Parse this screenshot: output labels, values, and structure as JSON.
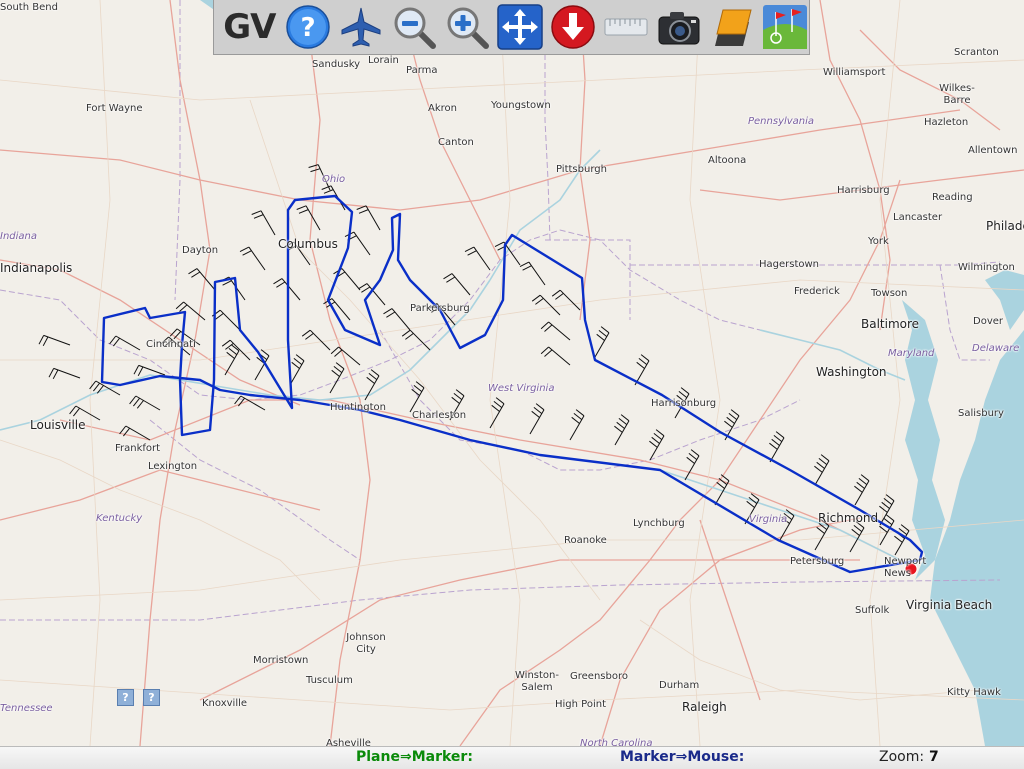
{
  "toolbar": {
    "title": "GV",
    "buttons": [
      {
        "name": "help",
        "icon": "help-icon"
      },
      {
        "name": "plane",
        "icon": "plane-icon"
      },
      {
        "name": "zoom-out",
        "icon": "zoom-out-icon"
      },
      {
        "name": "zoom-in",
        "icon": "zoom-in-icon"
      },
      {
        "name": "pan",
        "icon": "move-arrows-icon"
      },
      {
        "name": "download",
        "icon": "download-arrow-icon"
      },
      {
        "name": "ruler",
        "icon": "ruler-icon"
      },
      {
        "name": "camera",
        "icon": "camera-icon"
      },
      {
        "name": "layers",
        "icon": "layers-icon"
      },
      {
        "name": "google-earth",
        "icon": "google-earth-icon"
      }
    ]
  },
  "map": {
    "places": [
      "South Bend",
      "Fort Wayne",
      "Sandusky",
      "Lorain",
      "Parma",
      "Akron",
      "Youngstown",
      "Canton",
      "Pittsburgh",
      "Altoona",
      "Williamsport",
      "Wilkes-Barre",
      "Scranton",
      "Hazleton",
      "Allentown",
      "Harrisburg",
      "Reading",
      "Lancaster",
      "York",
      "Philadelphia",
      "Wilmington",
      "Hagerstown",
      "Frederick",
      "Towson",
      "Baltimore",
      "Dover",
      "Washington",
      "Salisbury",
      "Columbus",
      "Dayton",
      "Indianapolis",
      "Cincinnati",
      "Parkersburg",
      "Huntington",
      "Charleston",
      "Louisville",
      "Frankfort",
      "Lexington",
      "Harrisonburg",
      "Richmond",
      "Lynchburg",
      "Roanoke",
      "Petersburg",
      "Newport News",
      "Suffolk",
      "Virginia Beach",
      "Johnson City",
      "Morristown",
      "Tusculum",
      "Knoxville",
      "Asheville",
      "Winston-Salem",
      "Greensboro",
      "High Point",
      "Durham",
      "Raleigh",
      "Kitty Hawk"
    ],
    "states": [
      "Ohio",
      "Indiana",
      "Pennsylvania",
      "West Virginia",
      "Kentucky",
      "Virginia",
      "Maryland",
      "Delaware",
      "Tennessee",
      "North Carolina"
    ]
  },
  "help_buttons": [
    "?",
    "?"
  ],
  "status": {
    "plane_marker_label": "Plane⇒Marker:",
    "marker_mouse_label": "Marker⇒Mouse:",
    "zoom_label": "Zoom:",
    "zoom_value": "7"
  },
  "colors": {
    "track": "#0a2fc8",
    "marker": "#e8141e",
    "plane_marker_label": "#0a8a0a",
    "marker_mouse_label": "#1a2a8a",
    "water": "#aad3df"
  }
}
